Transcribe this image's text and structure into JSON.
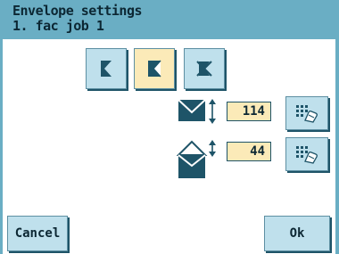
{
  "header": {
    "title": "Envelope settings",
    "subtitle": "1. fac job 1"
  },
  "toolbar": {
    "buttons": [
      {
        "icon": "flap-left-icon",
        "active": false
      },
      {
        "icon": "flap-right-icon",
        "active": true
      },
      {
        "icon": "flap-disabled-icon",
        "active": false
      }
    ]
  },
  "fields": {
    "envelope_height": {
      "value": "114",
      "icon": "envelope-height-icon"
    },
    "flap_height": {
      "value": "44",
      "icon": "flap-height-icon"
    }
  },
  "footer": {
    "cancel_label": "Cancel",
    "ok_label": "Ok"
  },
  "colors": {
    "header": "#6aaec4",
    "button": "#bfe0ec",
    "active": "#fbeab8",
    "ink": "#1e5468"
  }
}
